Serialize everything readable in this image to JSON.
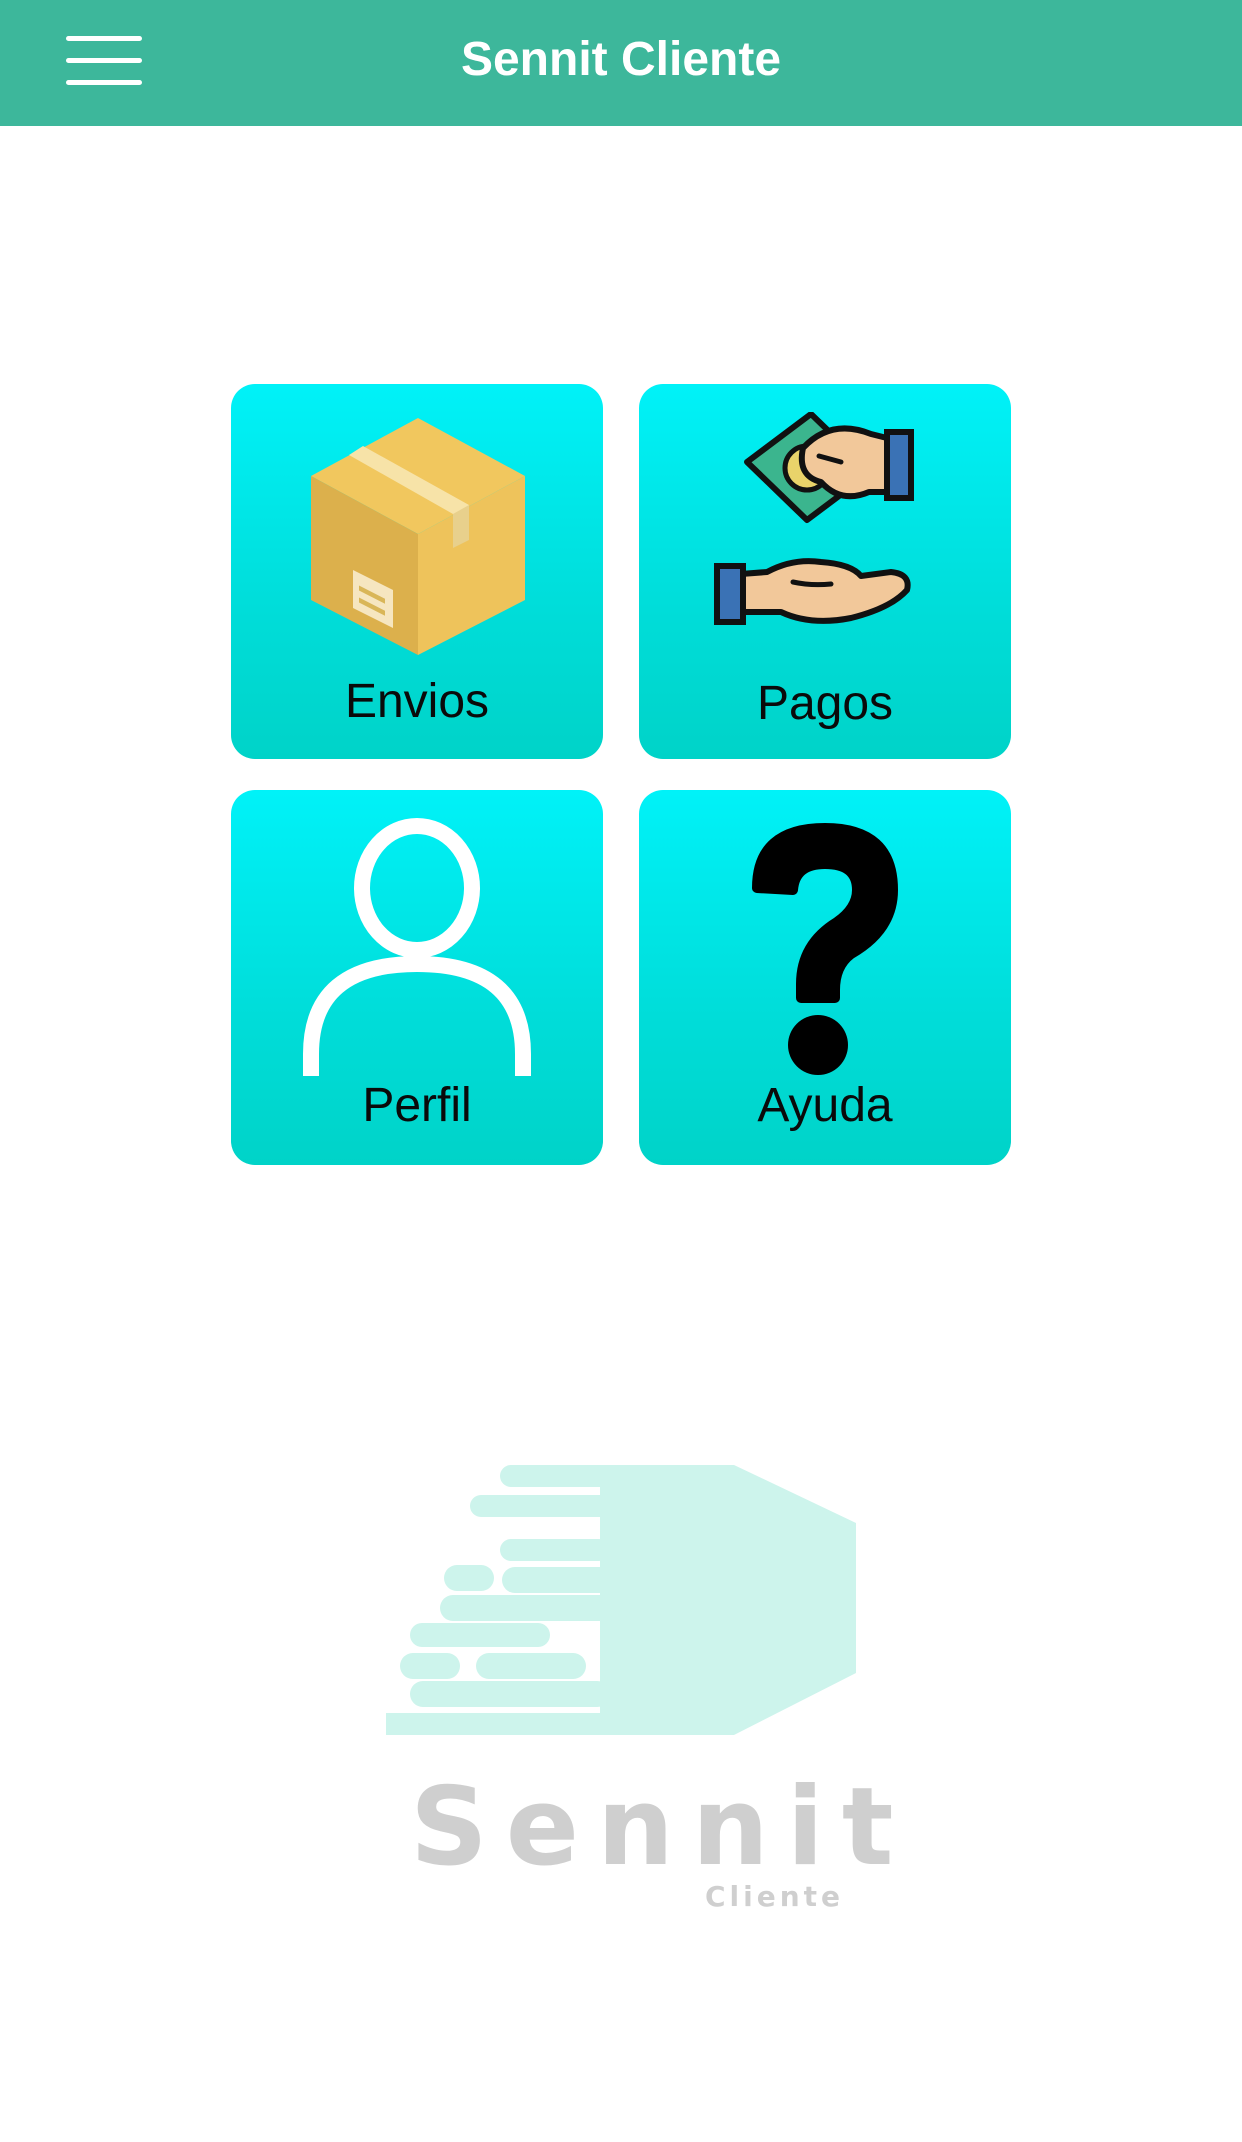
{
  "app": {
    "title": "Sennit Cliente"
  },
  "header": {
    "menu_icon": "hamburger-menu-icon",
    "background_color": "#3db79b"
  },
  "tiles": [
    {
      "label": "Envios",
      "icon": "package-box-icon"
    },
    {
      "label": "Pagos",
      "icon": "money-exchange-hands-icon"
    },
    {
      "label": "Perfil",
      "icon": "user-profile-icon"
    },
    {
      "label": "Ayuda",
      "icon": "question-mark-icon"
    }
  ],
  "logo": {
    "word": "Sennit",
    "subword": "Cliente"
  },
  "colors": {
    "accent": "#3db79b",
    "tile_top": "#00f2f8",
    "tile_bottom": "#00d3c8",
    "logo_mark": "#cdf4ec",
    "logo_text": "#cfcfcf"
  }
}
